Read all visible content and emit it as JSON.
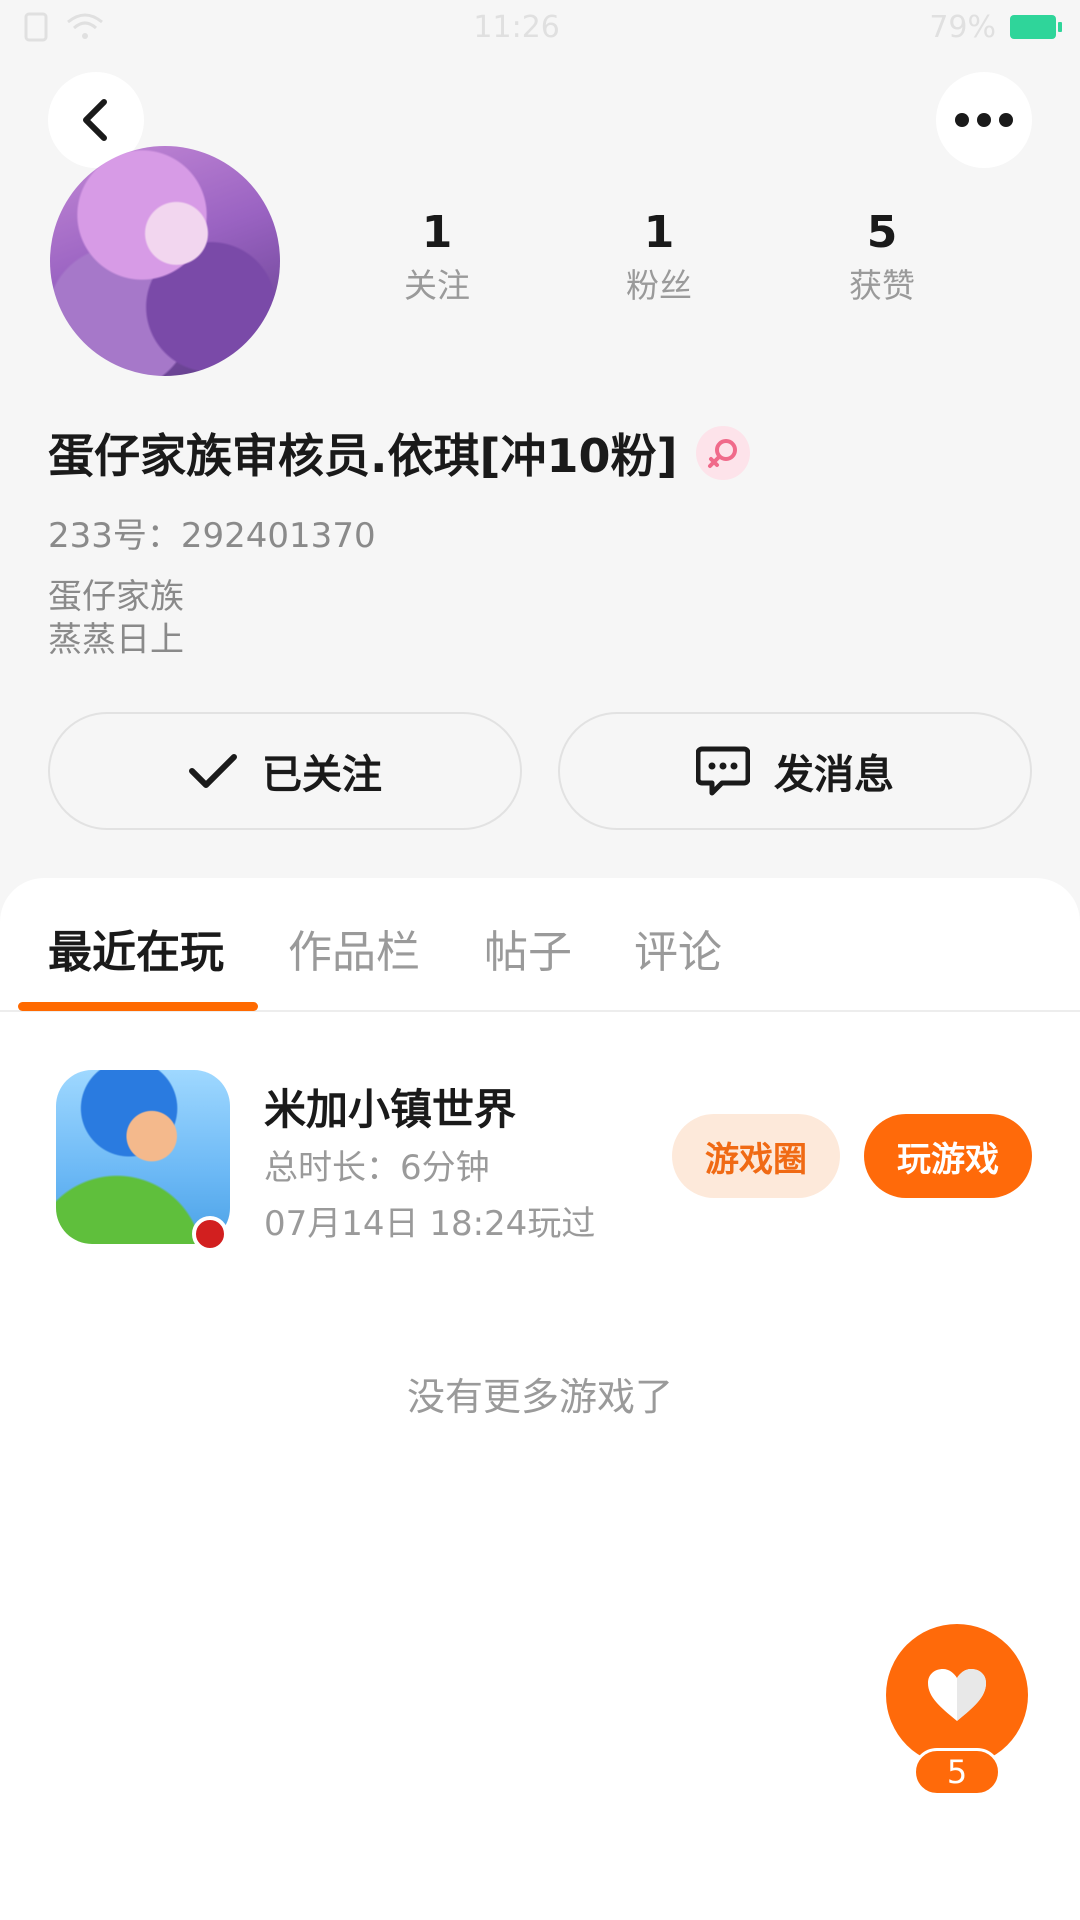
{
  "status_bar": {
    "time": "11:26",
    "battery": "79%"
  },
  "profile": {
    "stats": [
      {
        "value": "1",
        "label": "关注"
      },
      {
        "value": "1",
        "label": "粉丝"
      },
      {
        "value": "5",
        "label": "获赞"
      }
    ],
    "name": "蛋仔家族审核员.依琪[冲10粉]",
    "user_id": "233号：292401370",
    "bio_line1": "蛋仔家族",
    "bio_line2": "蒸蒸日上"
  },
  "actions": {
    "follow_label": "已关注",
    "message_label": "发消息"
  },
  "tabs": [
    {
      "label": "最近在玩"
    },
    {
      "label": "作品栏"
    },
    {
      "label": "帖子"
    },
    {
      "label": "评论"
    }
  ],
  "game": {
    "title": "米加小镇世界",
    "duration": "总时长：6分钟",
    "last_played": "07月14日 18:24玩过",
    "circle_label": "游戏圈",
    "play_label": "玩游戏"
  },
  "empty_text": "没有更多游戏了",
  "like": {
    "count": "5"
  },
  "colors": {
    "accent": "#ff6a0a",
    "accent_light": "#fde9da",
    "gender_pink": "#f06a8a"
  },
  "icons": {
    "back": "chevron-left-icon",
    "more": "ellipsis-icon",
    "gender": "female-icon",
    "check": "check-icon",
    "message": "chat-bubble-icon",
    "like": "heart-icon"
  }
}
